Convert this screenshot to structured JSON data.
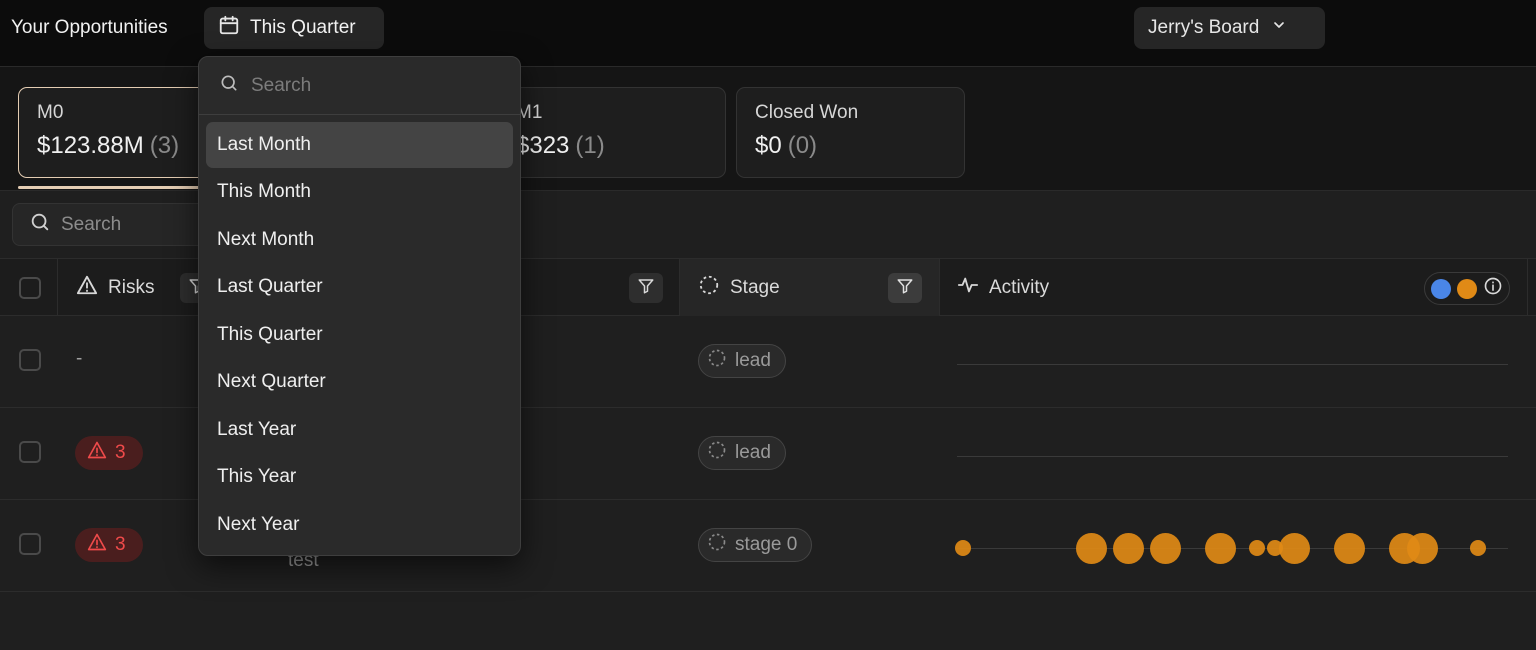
{
  "header": {
    "title": "Your Opportunities",
    "date_filter": "This Quarter",
    "board": "Jerry's Board"
  },
  "stages": [
    {
      "name": "M0",
      "amount": "$123.88M",
      "count": "(3)"
    },
    {
      "name": "M1",
      "amount": "$323",
      "count": "(1)"
    },
    {
      "name": "Closed Won",
      "amount": "$0",
      "count": "(0)"
    }
  ],
  "search": {
    "placeholder": "Search"
  },
  "columns": {
    "risks": "Risks",
    "stage": "Stage",
    "activity": "Activity"
  },
  "rows": [
    {
      "risk": "-",
      "stage": "lead"
    },
    {
      "risk": "3",
      "stage": "lead"
    },
    {
      "risk": "3",
      "stage": "stage 0",
      "name": "test"
    }
  ],
  "dropdown": {
    "search_placeholder": "Search",
    "items": [
      "Last Month",
      "This Month",
      "Next Month",
      "Last Quarter",
      "This Quarter",
      "Next Quarter",
      "Last Year",
      "This Year",
      "Next Year"
    ]
  },
  "colors": {
    "accent": "#e4cdb3",
    "activity_orange": "#e08a16",
    "activity_blue": "#4a86e8",
    "risk_red": "#ef4a4a"
  }
}
